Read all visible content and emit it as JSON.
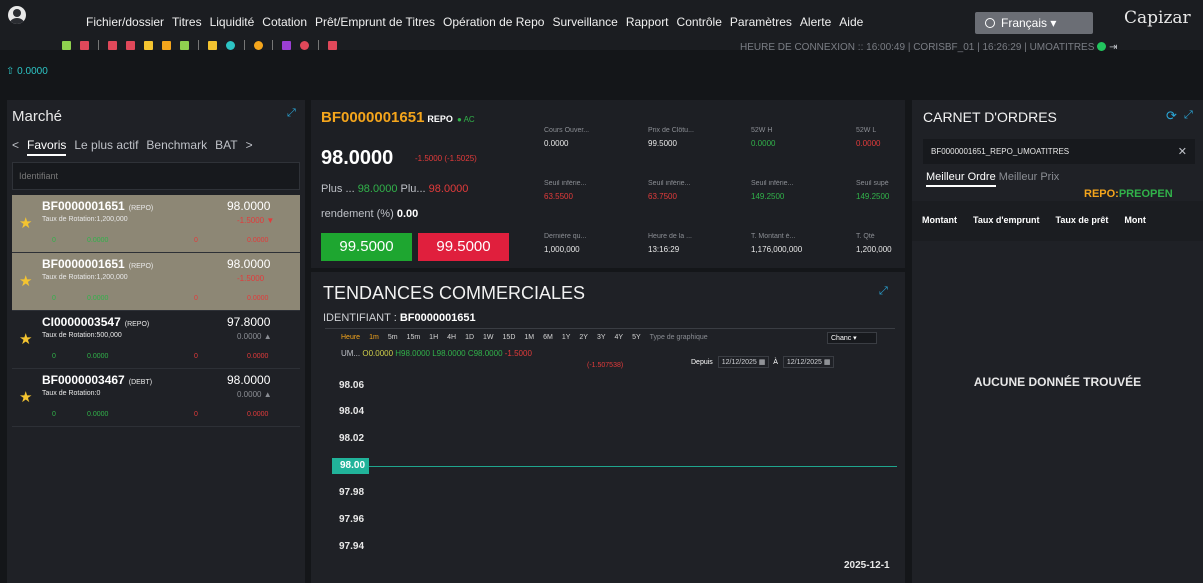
{
  "topbar": {
    "menu": [
      "Fichier/dossier",
      "Titres",
      "Liquidité",
      "Cotation",
      "Prêt/Emprunt de Titres",
      "Opération de Repo",
      "Surveillance",
      "Rapport",
      "Contrôle",
      "Paramètres",
      "Alerte",
      "Aide"
    ],
    "language": "Français",
    "brand": "Capizar",
    "connection": "HEURE DE CONNEXION :: 16:00:49 | CORISBF_01 | 16:26:29 | UMOATITRES",
    "ticker": "0.0000"
  },
  "market": {
    "title": "Marché",
    "tabs": [
      "Favoris",
      "Le plus actif",
      "Benchmark",
      "BAT"
    ],
    "identifier_placeholder": "Identifiant",
    "rows": [
      {
        "code": "BF0000001651",
        "type": "(REPO)",
        "price": "98.0000",
        "rotation": "Taux de Rotation:1,200,000",
        "change": "-1.5000",
        "b1": "0",
        "b2": "0.0000",
        "b3": "0",
        "b4": "0.0000"
      },
      {
        "code": "BF0000001651",
        "type": "(REPO)",
        "price": "98.0000",
        "rotation": "Taux de Rotation:1,200,000",
        "change": "-1.5000",
        "b1": "0",
        "b2": "0.0000",
        "b3": "0",
        "b4": "0.0000"
      },
      {
        "code": "CI0000003547",
        "type": "(REPO)",
        "price": "97.8000",
        "rotation": "Taux de Rotation:500,000",
        "change": "0.0000",
        "b1": "0",
        "b2": "0.0000",
        "b3": "0",
        "b4": "0.0000"
      },
      {
        "code": "BF0000003467",
        "type": "(DEBT)",
        "price": "98.0000",
        "rotation": "Taux de Rotation:0",
        "change": "0.0000",
        "b1": "0",
        "b2": "0.0000",
        "b3": "0",
        "b4": "0.0000"
      }
    ]
  },
  "security": {
    "code": "BF0000001651",
    "type": "REPO",
    "status": "AC",
    "price": "98.0000",
    "delta": "-1.5000 (-1.5025)",
    "plus1_label": "Plus ...",
    "plus1_value": "98.0000",
    "plus2_label": "Plu...",
    "plus2_value": "98.0000",
    "yield_label": "rendement (%)",
    "yield_value": "0.00",
    "bid": "99.5000",
    "ask": "99.5000",
    "stats": [
      {
        "label": "Cours Ouver...",
        "value": "0.0000",
        "tone": ""
      },
      {
        "label": "Prix de Clôtu...",
        "value": "99.5000",
        "tone": ""
      },
      {
        "label": "52W H",
        "value": "0.0000",
        "tone": "g"
      },
      {
        "label": "52W L",
        "value": "0.0000",
        "tone": "r"
      },
      {
        "label": "Seuil inférie...",
        "value": "63.5500",
        "tone": "r"
      },
      {
        "label": "Seuil inférie...",
        "value": "63.7500",
        "tone": "r"
      },
      {
        "label": "Seuil inférie...",
        "value": "149.2500",
        "tone": "g"
      },
      {
        "label": "Seuil supé",
        "value": "149.2500",
        "tone": "g"
      },
      {
        "label": "Dernière qu...",
        "value": "1,000,000",
        "tone": ""
      },
      {
        "label": "Heure de la ...",
        "value": "13:16:29",
        "tone": ""
      },
      {
        "label": "T. Montant é...",
        "value": "1,176,000,000",
        "tone": ""
      },
      {
        "label": "T. Qté",
        "value": "1,200,000",
        "tone": ""
      }
    ]
  },
  "chart_panel": {
    "title": "TENDANCES COMMERCIALES",
    "identifier_label": "IDENTIFIANT :",
    "identifier_value": "BF0000001651",
    "periods": [
      "Heure",
      "1m",
      "5m",
      "15m",
      "1H",
      "4H",
      "1D",
      "1W",
      "15D",
      "1M",
      "6M",
      "1Y",
      "2Y",
      "3Y",
      "4Y",
      "5Y"
    ],
    "chart_type_label": "Type de graphique",
    "chart_type_value": "Chanc",
    "ohlc_prefix": "UM...",
    "ohlc_o": "O0.0000",
    "ohlc_h": "H98.0000",
    "ohlc_l": "L98.0000",
    "ohlc_c": "C98.0000",
    "ohlc_change": "-1.5000",
    "ohlc_change2": "(-1.507538)",
    "since_label": "Depuis",
    "from_date": "12/12/2025",
    "to_label": "À",
    "to_date": "12/12/2025",
    "current_value_label": "98.00"
  },
  "chart_data": {
    "type": "line",
    "x": [
      "2025-12-1"
    ],
    "series": [
      {
        "values": [
          98.0
        ]
      }
    ],
    "yticks": [
      "98.06",
      "98.04",
      "98.02",
      "98.00",
      "97.98",
      "97.96",
      "97.94"
    ],
    "ylim": [
      97.93,
      98.07
    ],
    "xtick": "2025-12-1"
  },
  "orderbook": {
    "title": "CARNET D'ORDRES",
    "search_value": "BF0000001651_REPO_UMOATITRES",
    "tab_best_order": "Meilleur Ordre",
    "tab_best_price": "Meilleur Prix",
    "status_prefix": "REPO:",
    "status_value": "PREOPEN",
    "columns": [
      "Montant",
      "Taux d'emprunt",
      "Taux de prêt",
      "Mont"
    ],
    "empty": "AUCUNE DONNÉE TROUVÉE"
  }
}
